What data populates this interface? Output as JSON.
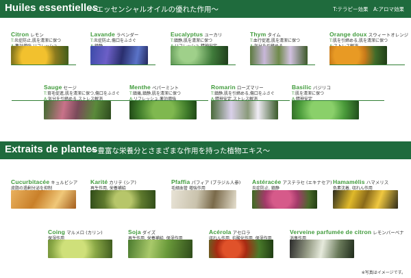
{
  "section1": {
    "title": "Huiles essentielles",
    "subtitle": "～エッセンシャルオイルの優れた作用～",
    "legend": "T:テラピー効果　A:アロマ効果"
  },
  "oils": [
    {
      "fr": "Citron",
      "jp": "レモン",
      "t": "T:",
      "t_text": "炎症防止,肌を清潔に保つ",
      "a": "A:",
      "a_text": "集効増強,リフレッシュ"
    },
    {
      "fr": "Lavande",
      "jp": "ラベンダー",
      "t": "T:",
      "t_text": "炎症防止,傷口をふさぐ",
      "a": "A:",
      "a_text": "鎮静"
    },
    {
      "fr": "Eucalyptus",
      "jp": "ユーカリ",
      "t": "T:",
      "t_text": "鎮静,肌を清潔に保つ",
      "a": "A:",
      "a_text": "リフレッシュ,精神安定"
    },
    {
      "fr": "Thym",
      "jp": "タイム",
      "t": "T:",
      "t_text": "血行促進,肌を清潔に保つ",
      "a": "A:",
      "a_text": "気分を引締める"
    },
    {
      "fr": "Orange doux",
      "jp": "スウィートオレンジ",
      "t": "T:",
      "t_text": "肌を引締める,肌を清潔に保つ",
      "a": "A:",
      "a_text": "ストレス解消"
    },
    {
      "fr": "Sauge",
      "jp": "セージ",
      "t": "T:",
      "t_text": "育毛促進,肌を清潔に保つ,傷口をふさぐ",
      "a": "A:",
      "a_text": "気分を引締める,ストレス解消"
    },
    {
      "fr": "Menthe",
      "jp": "ペパーミント",
      "t": "T:",
      "t_text": "鎮痛,鎮静,肌を清潔に保つ",
      "a": "A:",
      "a_text": "リフレッシュ,薬効増強"
    },
    {
      "fr": "Romarin",
      "jp": "ローズマリー",
      "t": "T:",
      "t_text": "鎮静,肌を引締める,傷口をふさぐ",
      "a": "A:",
      "a_text": "精神安定,ストレス解消"
    },
    {
      "fr": "Basilic",
      "jp": "バジリコ",
      "t": "T:",
      "t_text": "肌を清潔に保つ",
      "a": "A:",
      "a_text": "精神安定"
    }
  ],
  "section2": {
    "title": "Extraits de plantes",
    "subtitle": "～豊富な栄養分とさまざまな作用を持った植物エキス～"
  },
  "extracts": [
    {
      "fr": "Cucurbitacée",
      "jp": "キュルビシア",
      "desc": "皮脂の過剰分泌を抑制"
    },
    {
      "fr": "Karité",
      "jp": "カリテ (シア)",
      "desc": "再生作用, 栄養補給"
    },
    {
      "fr": "Pfaffia",
      "jp": "パフィア (ブラジル人参)",
      "desc": "毛細血管 増強作用"
    },
    {
      "fr": "Astéracée",
      "jp": "アステラセ (エキナセア)",
      "desc": "炎症防止, 鎮静"
    },
    {
      "fr": "Hamamélis",
      "jp": "ハマメリス",
      "desc": "色素沈着, 収れん作用"
    },
    {
      "fr": "Coing",
      "jp": "マルメロ (カリン)",
      "desc": "保湿作用"
    },
    {
      "fr": "Soja",
      "jp": "ダイズ",
      "desc": "再生作用, 栄養補給, 保湿作用"
    },
    {
      "fr": "Acérola",
      "jp": "アセロラ",
      "desc": "収れん作用, 抗酸化作用, 保湿作用"
    },
    {
      "fr": "Verveine parfumée de citron",
      "jp": "レモンバーベナ",
      "desc": "消臭作用"
    }
  ],
  "note": "※写真はイメージです。"
}
